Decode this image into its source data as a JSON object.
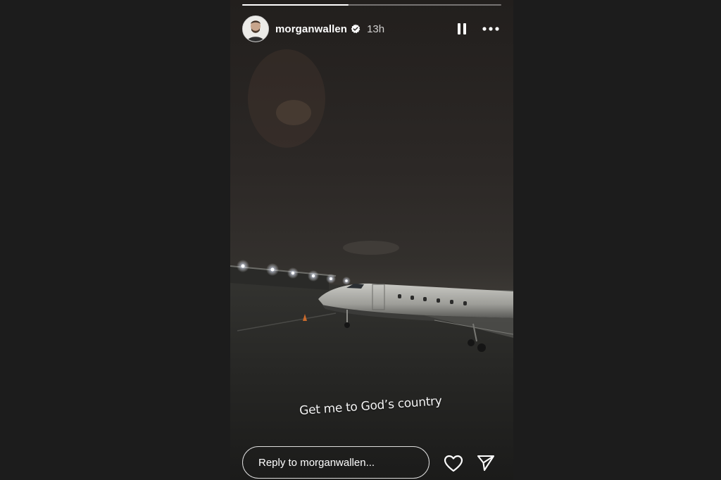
{
  "story": {
    "progress_fraction": 0.41,
    "user": {
      "username": "morganwallen",
      "verified": true,
      "time_ago": "13h"
    },
    "caption": "Get me to God’s country",
    "reply_placeholder": "Reply to morganwallen...",
    "icons": {
      "pause": "pause-icon",
      "more": "more-horizontal-icon",
      "like": "heart-icon",
      "share": "send-paper-plane-icon",
      "verified": "verified-badge-icon"
    }
  },
  "colors": {
    "page_background": "#1c1c1c",
    "story_sky": "#2a2725",
    "tarmac": "#252624",
    "text": "#ffffff"
  }
}
